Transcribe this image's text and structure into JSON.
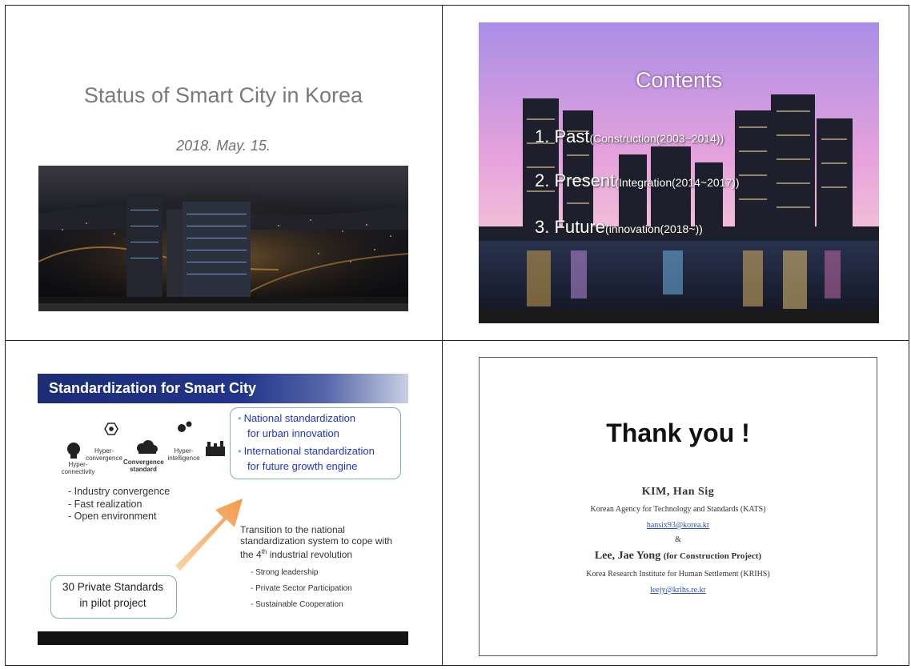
{
  "slide1": {
    "title": "Status of Smart City in Korea",
    "date": "2018.  May.  15."
  },
  "slide2": {
    "title": "Contents",
    "items": [
      {
        "main": "1. Past",
        "sub": "(Construction(2003~2014))"
      },
      {
        "main": "2. Present",
        "sub": "(Integration(2014~2017))"
      },
      {
        "main": "3. Future",
        "sub": "(innovation(2018~))"
      }
    ]
  },
  "slide3": {
    "header": "Standardization for Smart City",
    "bubble_items": [
      {
        "line1": "National standardization",
        "line2": "for  urban innovation"
      },
      {
        "line1": "International standardization",
        "line2": "for  future growth engine"
      }
    ],
    "labels": {
      "hyper_connectivity": "Hyper-\nconnectivity",
      "hyper_convergence": "Hyper-\nconvergence",
      "convergence_standard": "Convergence\nstandard",
      "hyper_intelligence": "Hyper-\nintelligence"
    },
    "features": [
      "- Industry convergence",
      "- Fast realization",
      "- Open environment"
    ],
    "transition_text_1": "Transition to the national standardization system to cope with the 4",
    "transition_sup": "th",
    "transition_text_2": " industrial revolution",
    "transition_items": [
      "Strong  leadership",
      "Private Sector Participation",
      "Sustainable Cooperation"
    ],
    "private_line1": "30 Private Standards",
    "private_line2": "in pilot project"
  },
  "slide4": {
    "thanks": "Thank you !",
    "person1_name": "KIM,  Han Sig",
    "person1_org": "Korean Agency for Technology and Standards (KATS)",
    "person1_email": "hansix93@korea.kr",
    "and": "&",
    "person2_name": "Lee,  Jae Yong",
    "person2_note": "(for Construction Project)",
    "person2_org": "Korea Research Institute for Human Settlement (KRIHS)",
    "person2_email": "leejy@krihs.re.kr"
  }
}
